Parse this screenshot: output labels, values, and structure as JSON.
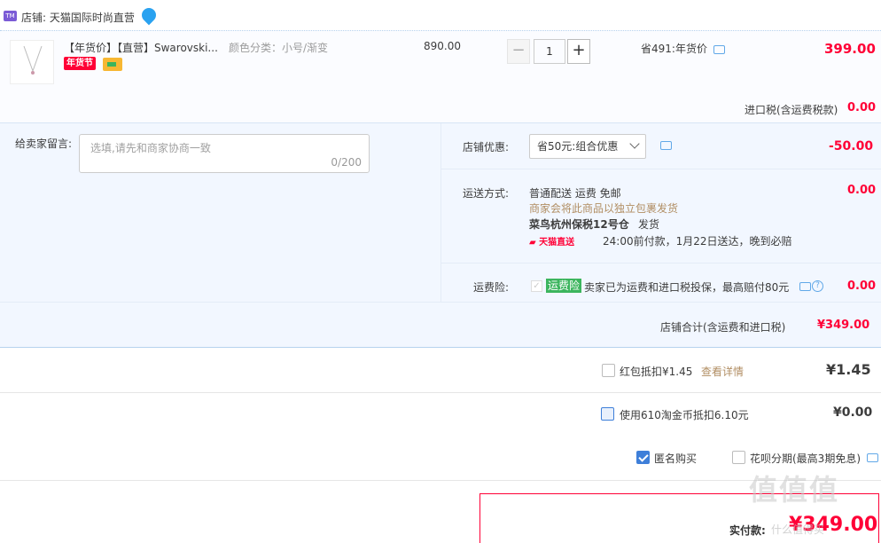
{
  "shop": {
    "label": "店铺: 天猫国际时尚直营",
    "icon": "tmall-shop-icon",
    "wangwang_icon": "wangwang-chat-icon"
  },
  "item": {
    "title": "【年货价】【直营】Swarovski...",
    "spec": "颜色分类：小号/渐变",
    "badge": "年货节",
    "unit_price": "890.00",
    "quantity": "1",
    "minus": "−",
    "plus": "+",
    "promo": "省491:年货价",
    "subtotal": "399.00",
    "tax_label": "进口税(含运费税款)",
    "tax_value": "0.00"
  },
  "message": {
    "label": "给卖家留言:",
    "placeholder": "选填,请先和商家协商一致",
    "counter": "0/200"
  },
  "discount": {
    "label": "店铺优惠:",
    "selected": "省50元:组合优惠",
    "value": "-50.00"
  },
  "shipping": {
    "label": "运送方式:",
    "line1": "普通配送 运费 免邮",
    "line2": "商家会将此商品以独立包裹发货",
    "warehouse": "菜鸟杭州保税12号仓",
    "ship_from": "发货",
    "tmall_direct": "天猫直送",
    "delivery": "24:00前付款，1月22日送达，晚到必赔",
    "value": "0.00"
  },
  "insurance": {
    "label": "运费险:",
    "badge": "运费险",
    "text": "卖家已为运费和进口税投保，最高赔付80元",
    "help": "?",
    "value": "0.00"
  },
  "shop_total": {
    "label": "店铺合计(含运费和进口税)",
    "value": "¥349.00"
  },
  "redpacket": {
    "label": "红包抵扣¥1.45",
    "link": "查看详情",
    "value": "¥1.45"
  },
  "taojinbi": {
    "label": "使用610淘金币抵扣6.10元",
    "value": "¥0.00"
  },
  "options": {
    "anonymous": "匿名购买",
    "huabei": "花呗分期(最高3期免息)"
  },
  "pay": {
    "label": "实付款:",
    "value": "¥349.00"
  },
  "watermark": {
    "main": "值值值",
    "sub": "什么值得买"
  },
  "colors": {
    "accent": "#ff0036",
    "panel": "#f2f7ff",
    "link": "#3e7fd9"
  }
}
